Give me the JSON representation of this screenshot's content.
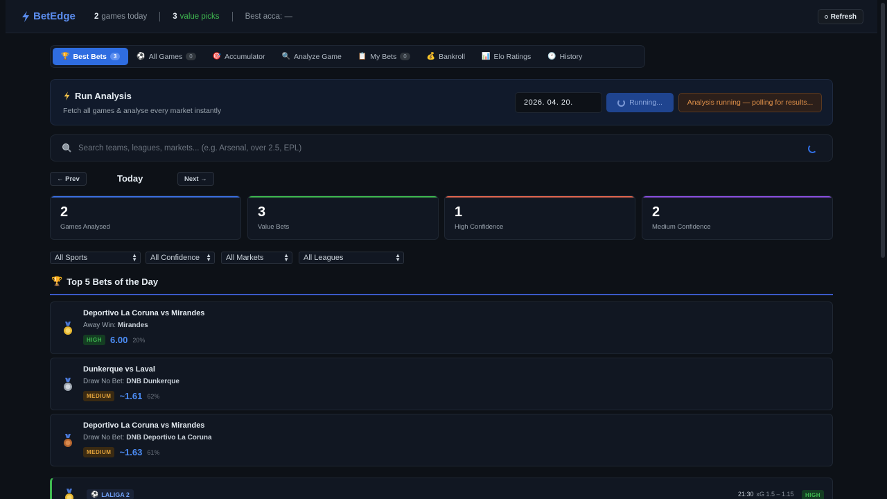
{
  "header": {
    "brand": "BetEdge",
    "games_today_count": "2",
    "games_today_label": "games today",
    "value_picks_count": "3",
    "value_picks_label": "value picks",
    "best_acca": "Best acca: —",
    "refresh_label": "Refresh"
  },
  "nav": {
    "tabs": [
      {
        "icon": "🏆",
        "label": "Best Bets",
        "badge": "3",
        "active": true
      },
      {
        "icon": "⚽",
        "label": "All Games",
        "badge": "0"
      },
      {
        "icon": "🎯",
        "label": "Accumulator"
      },
      {
        "icon": "🔍",
        "label": "Analyze Game"
      },
      {
        "icon": "📋",
        "label": "My Bets",
        "badge": "0"
      },
      {
        "icon": "💰",
        "label": "Bankroll"
      },
      {
        "icon": "📊",
        "label": "Elo Ratings"
      },
      {
        "icon": "🕐",
        "label": "History"
      }
    ]
  },
  "run": {
    "title": "Run Analysis",
    "subtitle": "Fetch all games & analyse every market instantly",
    "date": "2026. 04. 20.",
    "button_label": "Running...",
    "status": "Analysis running — polling for results..."
  },
  "search": {
    "placeholder": "Search teams, leagues, markets... (e.g. Arsenal, over 2.5, EPL)"
  },
  "datenav": {
    "prev": "← Prev",
    "label": "Today",
    "next": "Next →"
  },
  "stats": [
    {
      "value": "2",
      "label": "Games Analysed",
      "accent": "#3b6fe0"
    },
    {
      "value": "3",
      "label": "Value Bets",
      "accent": "#3fb950"
    },
    {
      "value": "1",
      "label": "High Confidence",
      "accent": "#e0664f"
    },
    {
      "value": "2",
      "label": "Medium Confidence",
      "accent": "#8b4fe0"
    }
  ],
  "filters": {
    "sports": "All Sports",
    "confidence": "All Confidence",
    "markets": "All Markets",
    "leagues": "All Leagues"
  },
  "section": {
    "icon": "🏆",
    "title": "Top 5 Bets of the Day"
  },
  "bets": [
    {
      "medal": "gold",
      "match": "Deportivo La Coruna vs Mirandes",
      "market": "Away Win:",
      "pick": "Mirandes",
      "confidence": "HIGH",
      "odds": "6.00",
      "pct": "20%"
    },
    {
      "medal": "silver",
      "match": "Dunkerque vs Laval",
      "market": "Draw No Bet:",
      "pick": "DNB Dunkerque",
      "confidence": "MEDIUM",
      "odds": "~1.61",
      "pct": "62%"
    },
    {
      "medal": "bronze",
      "match": "Deportivo La Coruna vs Mirandes",
      "market": "Draw No Bet:",
      "pick": "DNB Deportivo La Coruna",
      "confidence": "MEDIUM",
      "odds": "~1.63",
      "pct": "61%"
    }
  ],
  "game": {
    "league": "LALIGA 2",
    "time": "21:30",
    "xg": "xG 1.5 – 1.15",
    "confidence": "HIGH"
  },
  "colors": {
    "accent": "#2f6de1",
    "green": "#3fb950",
    "orange": "#e3924a"
  }
}
